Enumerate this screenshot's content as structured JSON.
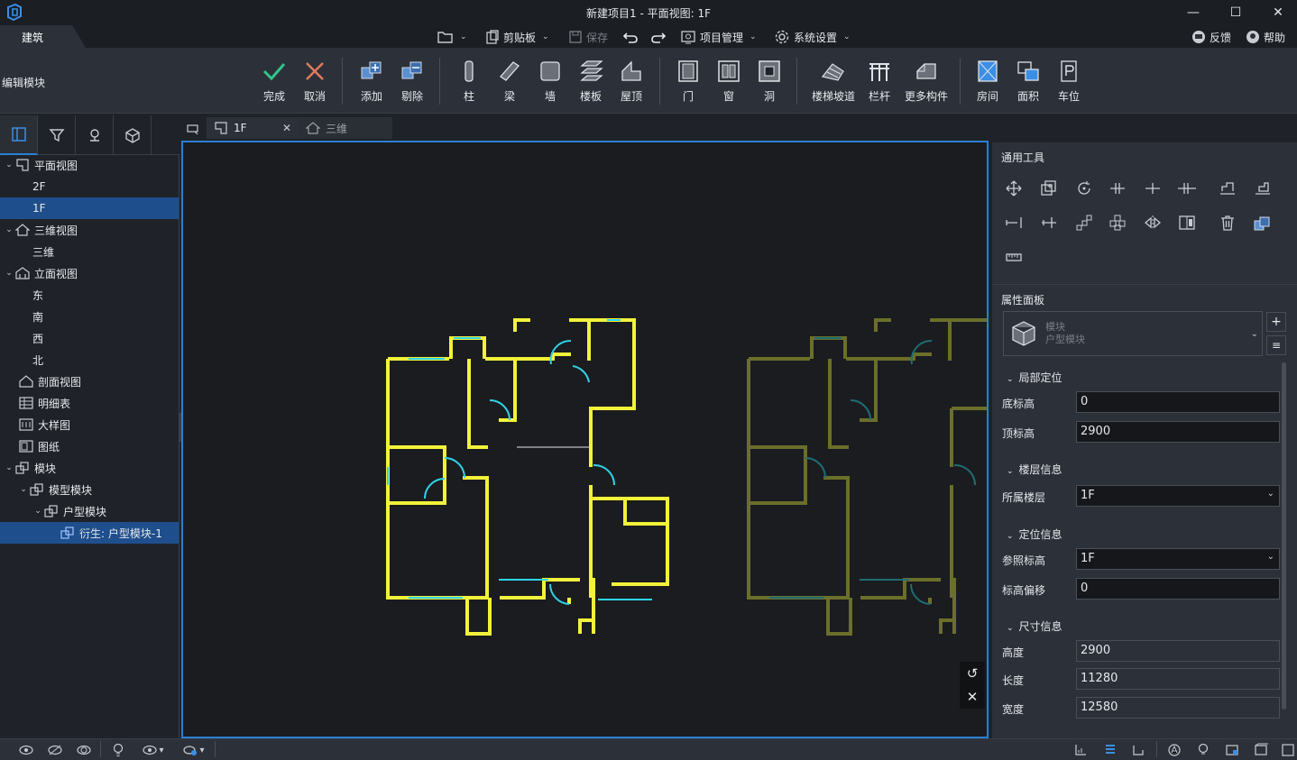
{
  "window": {
    "title": "新建项目1 - 平面视图: 1F",
    "minimize": "—",
    "maximize": "☐",
    "close": "✕"
  },
  "menu": {
    "tab_build": "建筑",
    "clipboard": "剪贴板",
    "save": "保存",
    "project_manage": "项目管理",
    "system_settings": "系统设置",
    "feedback": "反馈",
    "help": "帮助"
  },
  "ribbon": {
    "title": "编辑模块",
    "buttons": {
      "done": "完成",
      "cancel": "取消",
      "add": "添加",
      "remove": "剔除",
      "column": "柱",
      "beam": "梁",
      "wall": "墙",
      "slab": "楼板",
      "roof": "屋顶",
      "door": "门",
      "window": "窗",
      "opening": "洞",
      "stair_ramp": "楼梯坡道",
      "railing": "栏杆",
      "more": "更多构件",
      "room": "房间",
      "area": "面积",
      "parking": "车位"
    }
  },
  "tree": {
    "plan_view": "平面视图",
    "floor_2f": "2F",
    "floor_1f": "1F",
    "view_3d": "三维视图",
    "three_d": "三维",
    "elevation_view": "立面视图",
    "east": "东",
    "south": "南",
    "west": "西",
    "north": "北",
    "section_view": "剖面视图",
    "schedule": "明细表",
    "detail": "大样图",
    "sheet": "图纸",
    "module": "模块",
    "model_module": "模型模块",
    "unit_module": "户型模块",
    "derived": "衍生: 户型模块-1"
  },
  "doc_tabs": {
    "active": "1F",
    "other": "三维"
  },
  "right_panel": {
    "common_tools": "通用工具",
    "properties": "属性面板",
    "type_line1": "模块",
    "type_line2": "户型模块",
    "group_local": "局部定位",
    "bottom_elev_label": "底标高",
    "bottom_elev": "0",
    "top_elev_label": "顶标高",
    "top_elev": "2900",
    "group_floor": "楼层信息",
    "floor_label": "所属楼层",
    "floor": "1F",
    "group_position": "定位信息",
    "ref_elev_label": "参照标高",
    "ref_elev": "1F",
    "elev_offset_label": "标高偏移",
    "elev_offset": "0",
    "group_size": "尺寸信息",
    "height_label": "高度",
    "height": "2900",
    "length_label": "长度",
    "length": "11280",
    "width_label": "宽度",
    "width": "12580"
  },
  "colors": {
    "accent": "#2a7fd4",
    "wall_active": "#f2f23a",
    "window_active": "#2fd3e6",
    "wall_inactive": "#6b6f2a"
  }
}
